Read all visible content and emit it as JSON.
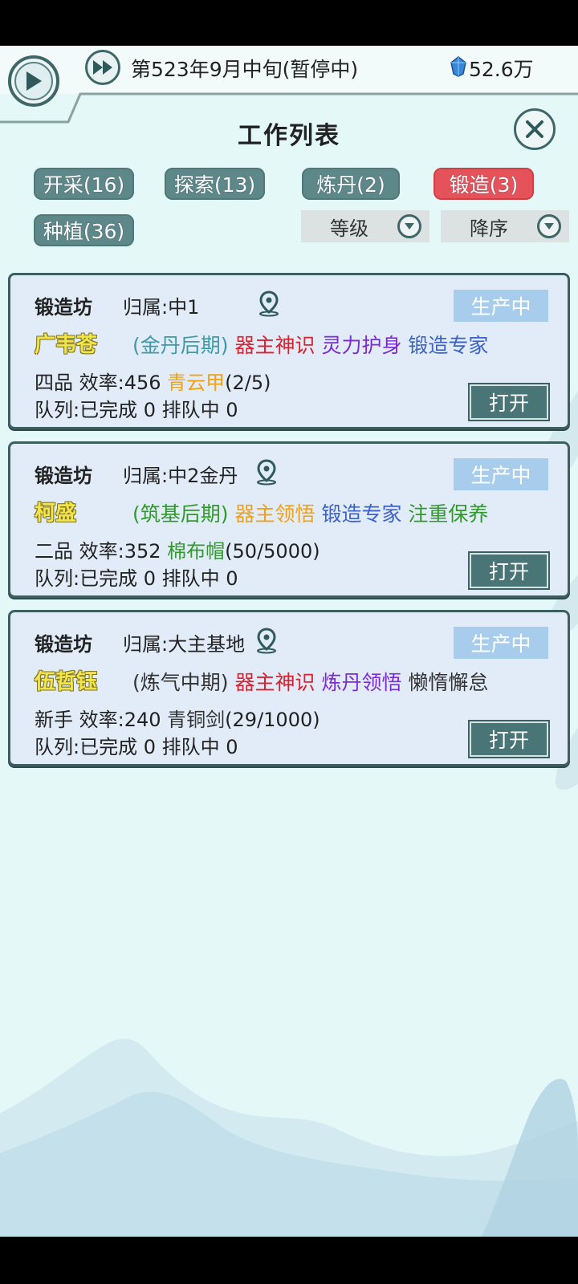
{
  "header": {
    "date_text": "第523年9月中旬(暂停中)",
    "currency_value": "52.6万",
    "currency_icon": "blue-gem-icon",
    "play_icon": "play-icon",
    "fast_forward_icon": "fast-forward-icon"
  },
  "panel": {
    "title": "工作列表",
    "close_icon": "close-icon"
  },
  "tabs": [
    {
      "label": "开采(16)",
      "active": false
    },
    {
      "label": "探索(13)",
      "active": false
    },
    {
      "label": "炼丹(2)",
      "active": false
    },
    {
      "label": "锻造(3)",
      "active": true
    },
    {
      "label": "种植(36)",
      "active": false
    }
  ],
  "sort": {
    "field_label": "等级",
    "order_label": "降序"
  },
  "cards": [
    {
      "type": "锻造坊",
      "owner": "归属:中1",
      "status": "生产中",
      "worker": "广韦苍",
      "realm": "(金丹后期)",
      "realm_color": "#3f9aa8",
      "traits": [
        {
          "text": "器主神识",
          "color": "#e0202e"
        },
        {
          "text": "灵力护身",
          "color": "#7c2ad6"
        },
        {
          "text": "锻造专家",
          "color": "#3c62c8"
        }
      ],
      "rank_eff": "四品 效率:456",
      "product": "青云甲",
      "product_color": "#f0a11a",
      "progress": "(2/5)",
      "queue": "队列:已完成 0 排队中 0",
      "open_label": "打开"
    },
    {
      "type": "锻造坊",
      "owner": "归属:中2金丹",
      "status": "生产中",
      "worker": "柯盛",
      "realm": "(筑基后期)",
      "realm_color": "#2f9a2a",
      "traits": [
        {
          "text": "器主领悟",
          "color": "#f0a11a"
        },
        {
          "text": "锻造专家",
          "color": "#3c62c8"
        },
        {
          "text": "注重保养",
          "color": "#2f9a2a"
        }
      ],
      "rank_eff": "二品 效率:352",
      "product": "棉布帽",
      "product_color": "#2f9a2a",
      "progress": "(50/5000)",
      "queue": "队列:已完成 0 排队中 0",
      "open_label": "打开"
    },
    {
      "type": "锻造坊",
      "owner": "归属:大主基地",
      "status": "生产中",
      "worker": "伍哲钰",
      "realm": "(炼气中期)",
      "realm_color": "#333333",
      "traits": [
        {
          "text": "器主神识",
          "color": "#e0202e"
        },
        {
          "text": "炼丹领悟",
          "color": "#7c2ad6"
        },
        {
          "text": "懒惰懈怠",
          "color": "#333333"
        }
      ],
      "rank_eff": "新手 效率:240",
      "product": "青铜剑",
      "product_color": "#333333",
      "progress": "(29/1000)",
      "queue": "队列:已完成 0 排队中 0",
      "open_label": "打开"
    }
  ],
  "location_icon": "map-pin-icon",
  "sort_arrow_icon": "chevron-down-icon"
}
